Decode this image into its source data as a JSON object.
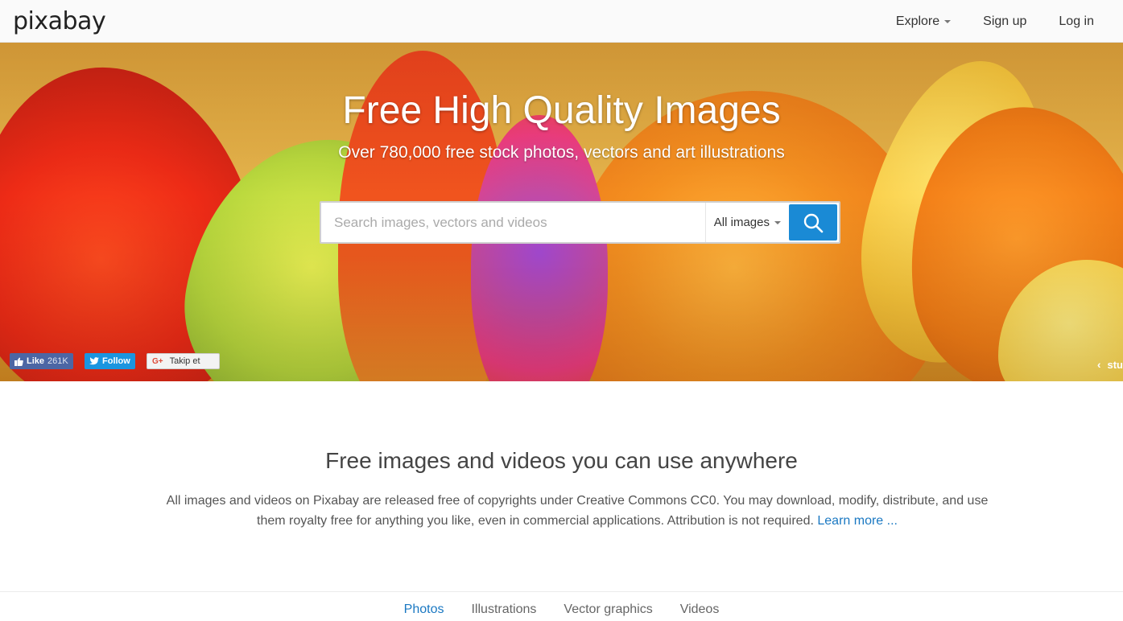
{
  "header": {
    "logo": "pixabay",
    "nav": {
      "explore": "Explore",
      "signup": "Sign up",
      "login": "Log in"
    }
  },
  "hero": {
    "title": "Free High Quality Images",
    "subtitle": "Over 780,000 free stock photos, vectors and art illustrations",
    "search": {
      "placeholder": "Search images, vectors and videos",
      "value": "",
      "type_selected": "All images"
    },
    "social": {
      "facebook_label": "Like",
      "facebook_count": "261K",
      "twitter_label": "Follow",
      "google_icon": "G+",
      "google_label": "Takip et"
    },
    "credit": "stu"
  },
  "intro": {
    "title": "Free images and videos you can use anywhere",
    "text": "All images and videos on Pixabay are released free of copyrights under Creative Commons CC0. You may download, modify, distribute, and use them royalty free for anything you like, even in commercial applications. Attribution is not required.",
    "link": "Learn more ..."
  },
  "tabs": [
    {
      "label": "Photos",
      "active": true
    },
    {
      "label": "Illustrations",
      "active": false
    },
    {
      "label": "Vector graphics",
      "active": false
    },
    {
      "label": "Videos",
      "active": false
    }
  ],
  "colors": {
    "accent": "#1a8ad5",
    "link": "#1a78c2",
    "facebook": "#4c66a4",
    "twitter": "#1b95e0"
  }
}
